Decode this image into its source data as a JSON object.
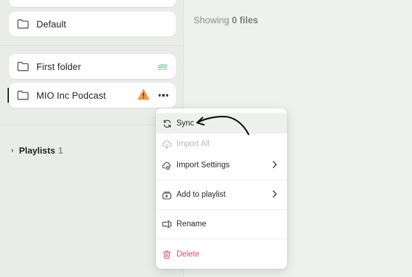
{
  "sidebar": {
    "folders": [
      {
        "label": ""
      },
      {
        "label": "Default"
      },
      {
        "label": "First folder"
      },
      {
        "label": "MIO Inc Podcast"
      }
    ],
    "playlists": {
      "title": "Playlists",
      "count": "1"
    }
  },
  "main": {
    "showing_prefix": "Showing",
    "showing_count": "0 files"
  },
  "context_menu": {
    "items": [
      {
        "label": "Sync",
        "icon": "sync-icon"
      },
      {
        "label": "Import All",
        "icon": "cloud-download-icon",
        "disabled": true
      },
      {
        "label": "Import Settings",
        "icon": "cloud-settings-icon",
        "submenu": true
      },
      {
        "label": "Add to playlist",
        "icon": "playlist-add-icon",
        "submenu": true
      },
      {
        "label": "Rename",
        "icon": "rename-icon"
      },
      {
        "label": "Delete",
        "icon": "trash-icon",
        "danger": true
      }
    ]
  },
  "colors": {
    "accent_warning": "#f2994a",
    "danger": "#e0485b",
    "sync_status": "#6fcf97"
  }
}
